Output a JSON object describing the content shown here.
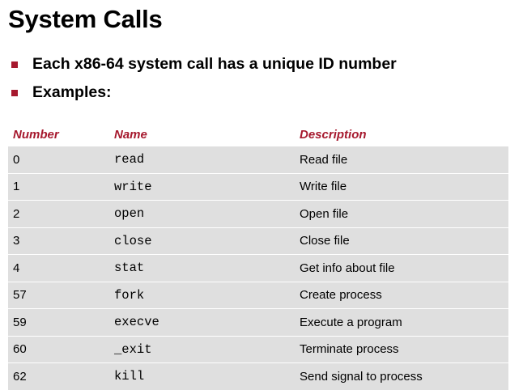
{
  "slide": {
    "title": "System Calls",
    "bullets": [
      "Each x86-64 system call has a unique ID number",
      "Examples:"
    ]
  },
  "table": {
    "headers": {
      "number": "Number",
      "name": "Name",
      "description": "Description"
    },
    "rows": [
      {
        "number": "0",
        "name": "read",
        "description": "Read file"
      },
      {
        "number": "1",
        "name": "write",
        "description": "Write file"
      },
      {
        "number": "2",
        "name": "open",
        "description": "Open file"
      },
      {
        "number": "3",
        "name": "close",
        "description": "Close file"
      },
      {
        "number": "4",
        "name": "stat",
        "description": "Get info about file"
      },
      {
        "number": "57",
        "name": "fork",
        "description": "Create process"
      },
      {
        "number": "59",
        "name": "execve",
        "description": "Execute a program"
      },
      {
        "number": "60",
        "name": "_exit",
        "description": "Terminate process"
      },
      {
        "number": "62",
        "name": "kill",
        "description": "Send signal to process"
      }
    ]
  },
  "colors": {
    "accent": "#a6192e",
    "bullet": "#a6192e",
    "row_background": "#dfdfdf",
    "text": "#000000"
  }
}
